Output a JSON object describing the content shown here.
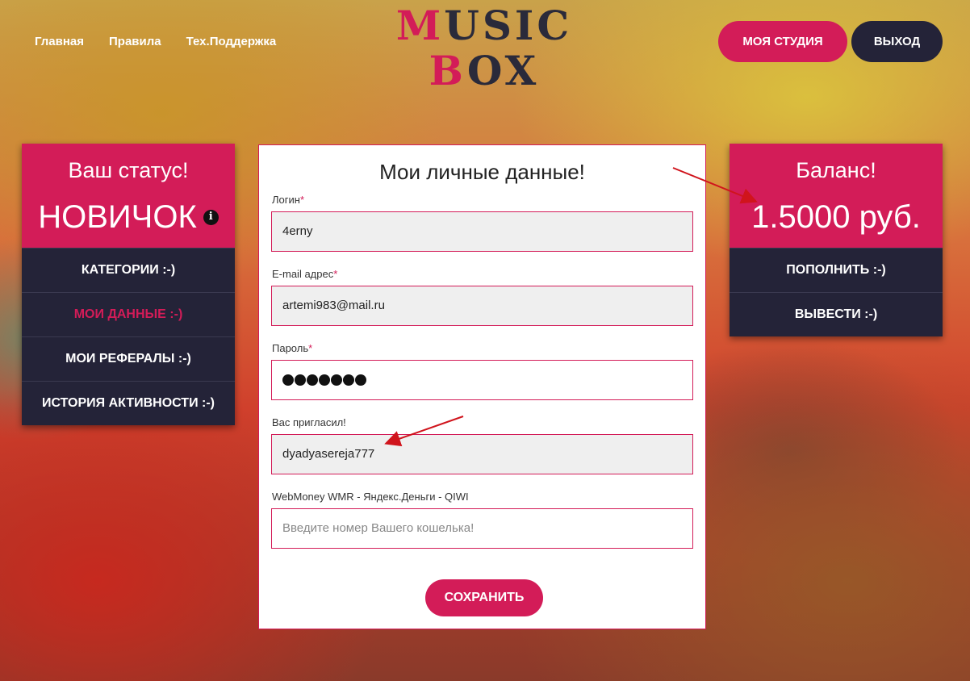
{
  "nav": {
    "home": "Главная",
    "rules": "Правила",
    "support": "Тех.Поддержка"
  },
  "logo": {
    "line1_pink": "M",
    "line1_rest": "USIC",
    "line2_pink": "B",
    "line2_rest": "OX"
  },
  "header": {
    "studio_button": "МОЯ СТУДИЯ",
    "exit_button": "ВЫХОД"
  },
  "status_panel": {
    "caption": "Ваш статус!",
    "status": "НОВИЧОК",
    "info_icon": "i",
    "menu": [
      "КАТЕГОРИИ :-)",
      "МОИ ДАННЫЕ :-)",
      "МОИ РЕФЕРАЛЫ :-)",
      "ИСТОРИЯ АКТИВНОСТИ :-)"
    ]
  },
  "balance_panel": {
    "caption": "Баланс!",
    "amount": "1.5000 руб.",
    "menu": [
      "ПОПОЛНИТЬ :-)",
      "ВЫВЕСТИ :-)"
    ]
  },
  "form": {
    "title": "Мои личные данные!",
    "login_label": "Логин",
    "login_value": "4erny",
    "email_label": "E-mail адрес",
    "email_value": "artemi983@mail.ru",
    "password_label": "Пароль",
    "inviter_label": "Вас пригласил!",
    "inviter_value": "dyadyasereja777",
    "wallet_label": "WebMoney WMR - Яндекс.Деньги - QIWI",
    "wallet_placeholder": "Введите номер Вашего кошелька!",
    "required_mark": "*",
    "save_button": "СОХРАНИТЬ"
  },
  "colors": {
    "accent": "#d31c58",
    "dark": "#242338"
  }
}
